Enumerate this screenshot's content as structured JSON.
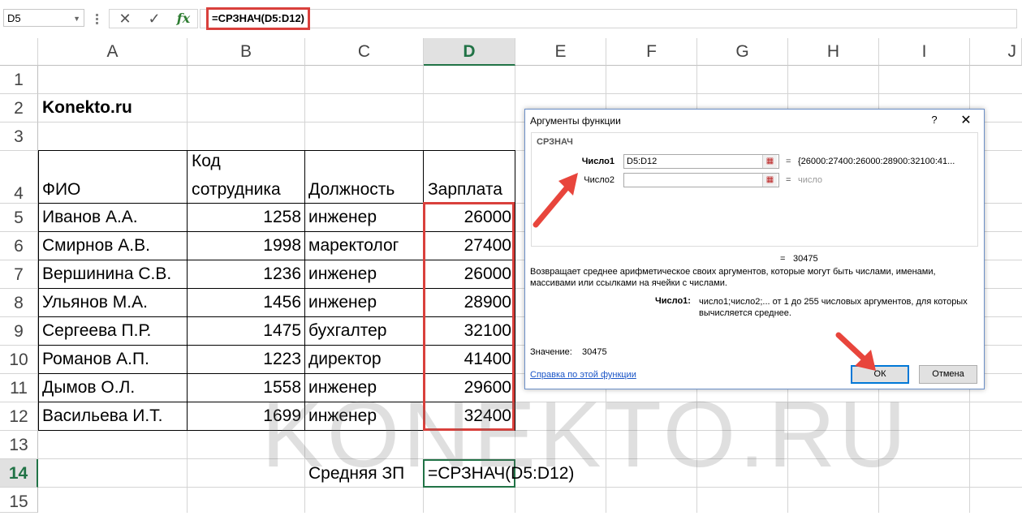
{
  "formula_bar": {
    "name_box": "D5",
    "cancel_icon": "✕",
    "enter_icon": "✓",
    "fx_icon": "fx",
    "formula": "=СРЗНАЧ(D5:D12)"
  },
  "columns": [
    "A",
    "B",
    "C",
    "D",
    "E",
    "F",
    "G",
    "H",
    "I",
    "J"
  ],
  "rows": [
    "1",
    "2",
    "3",
    "4",
    "5",
    "6",
    "7",
    "8",
    "9",
    "10",
    "11",
    "12",
    "13",
    "14",
    "15"
  ],
  "sheet": {
    "title": "Konekto.ru",
    "headers": {
      "fio": "ФИО",
      "code_line1": "Код",
      "code_line2": "сотрудника",
      "position": "Должность",
      "salary": "Зарплата"
    },
    "employees": [
      {
        "name": "Иванов А.А.",
        "code": "1258",
        "position": "инженер",
        "salary": "26000"
      },
      {
        "name": "Смирнов А.В.",
        "code": "1998",
        "position": "маректолог",
        "salary": "27400"
      },
      {
        "name": "Вершинина С.В.",
        "code": "1236",
        "position": "инженер",
        "salary": "26000"
      },
      {
        "name": "Ульянов М.А.",
        "code": "1456",
        "position": "инженер",
        "salary": "28900"
      },
      {
        "name": "Сергеева П.Р.",
        "code": "1475",
        "position": "бухгалтер",
        "salary": "32100"
      },
      {
        "name": "Романов А.П.",
        "code": "1223",
        "position": "директор",
        "salary": "41400"
      },
      {
        "name": "Дымов О.Л.",
        "code": "1558",
        "position": "инженер",
        "salary": "29600"
      },
      {
        "name": "Васильева И.Т.",
        "code": "1699",
        "position": "инженер",
        "salary": "32400"
      }
    ],
    "avg_label": "Средняя ЗП",
    "avg_formula": "=СРЗНАЧ(D5:D12)"
  },
  "watermark": "KONEKTO.RU",
  "dialog": {
    "title": "Аргументы функции",
    "help": "?",
    "close": "✕",
    "function_name": "СРЗНАЧ",
    "arg1_label": "Число1",
    "arg1_value": "D5:D12",
    "arg1_result": "{26000:27400:26000:28900:32100:41...",
    "arg2_label": "Число2",
    "arg2_value": "",
    "arg2_result": "число",
    "eq": "=",
    "result": "30475",
    "description": "Возвращает среднее арифметическое своих аргументов, которые могут быть числами, именами, массивами или ссылками на ячейки с числами.",
    "arg_desc_name": "Число1:",
    "arg_desc": "число1;число2;... от 1 до 255 числовых аргументов, для которых вычисляется среднее.",
    "value_label": "Значение:",
    "value": "30475",
    "help_link": "Справка по этой функции",
    "ok": "ОК",
    "cancel": "Отмена"
  },
  "colors": {
    "accent_green": "#217346",
    "highlight_red": "#d9403c",
    "dialog_border": "#6b8fc7"
  }
}
